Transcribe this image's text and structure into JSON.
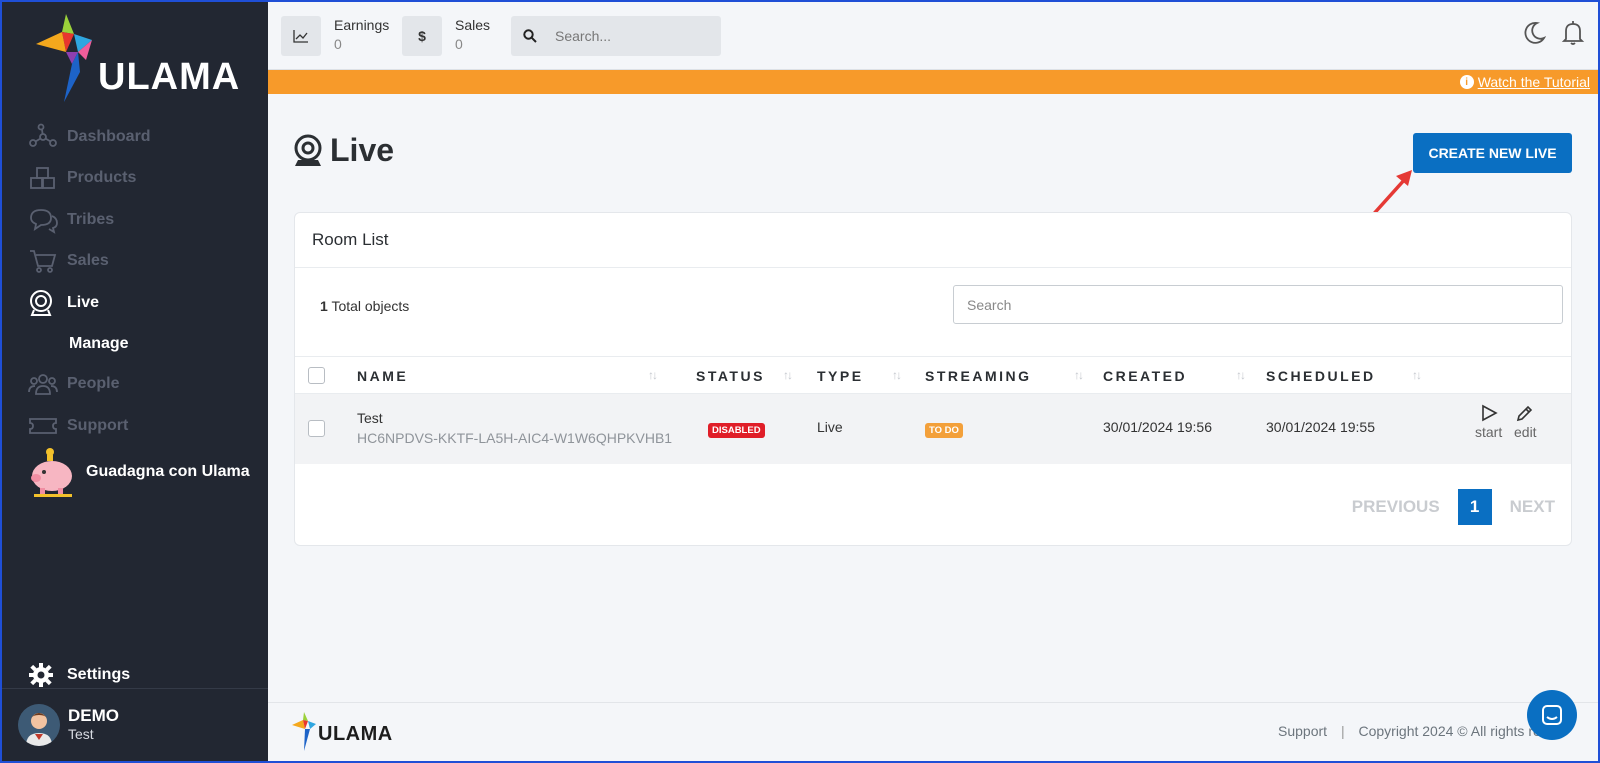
{
  "brand": {
    "name": "ULAMA"
  },
  "sidebar": {
    "items": [
      {
        "label": "Dashboard",
        "icon": "dashboard-icon"
      },
      {
        "label": "Products",
        "icon": "products-icon"
      },
      {
        "label": "Tribes",
        "icon": "tribes-icon"
      },
      {
        "label": "Sales",
        "icon": "cart-icon"
      },
      {
        "label": "Live",
        "icon": "webcam-icon",
        "active": true
      },
      {
        "label": "Manage",
        "sub": true
      },
      {
        "label": "People",
        "icon": "people-icon"
      },
      {
        "label": "Support",
        "icon": "ticket-icon"
      }
    ],
    "promo_label": "Guadagna con Ulama",
    "settings_label": "Settings",
    "user": {
      "name": "DEMO",
      "subtitle": "Test"
    }
  },
  "topbar": {
    "earnings": {
      "label": "Earnings",
      "value": "0"
    },
    "sales": {
      "label": "Sales",
      "value": "0",
      "icon_glyph": "$"
    },
    "search_placeholder": "Search..."
  },
  "banner": {
    "link_label": "Watch the Tutorial",
    "color": "#f79a2a"
  },
  "page": {
    "title": "Live",
    "create_button": "CREATE NEW LIVE"
  },
  "room_list": {
    "title": "Room List",
    "total_count": "1",
    "total_label": "Total objects",
    "search_placeholder": "Search",
    "columns": [
      "NAME",
      "STATUS",
      "TYPE",
      "STREAMING",
      "CREATED",
      "SCHEDULED"
    ],
    "rows": [
      {
        "name": "Test",
        "code": "HC6NPDVS-KKTF-LA5H-AIC4-W1W6QHPKVHB1",
        "status": "DISABLED",
        "type": "Live",
        "streaming": "TO DO",
        "created": "30/01/2024 19:56",
        "scheduled": "30/01/2024 19:55",
        "actions": [
          "start",
          "edit"
        ]
      }
    ],
    "pagination": {
      "previous": "PREVIOUS",
      "current": "1",
      "next": "NEXT"
    }
  },
  "footer": {
    "support": "Support",
    "copyright": "Copyright 2024 © All rights res"
  },
  "colors": {
    "accent": "#0a6fc2",
    "sidebar": "#222732",
    "danger": "#e01e28",
    "warning": "#f3a03a"
  }
}
